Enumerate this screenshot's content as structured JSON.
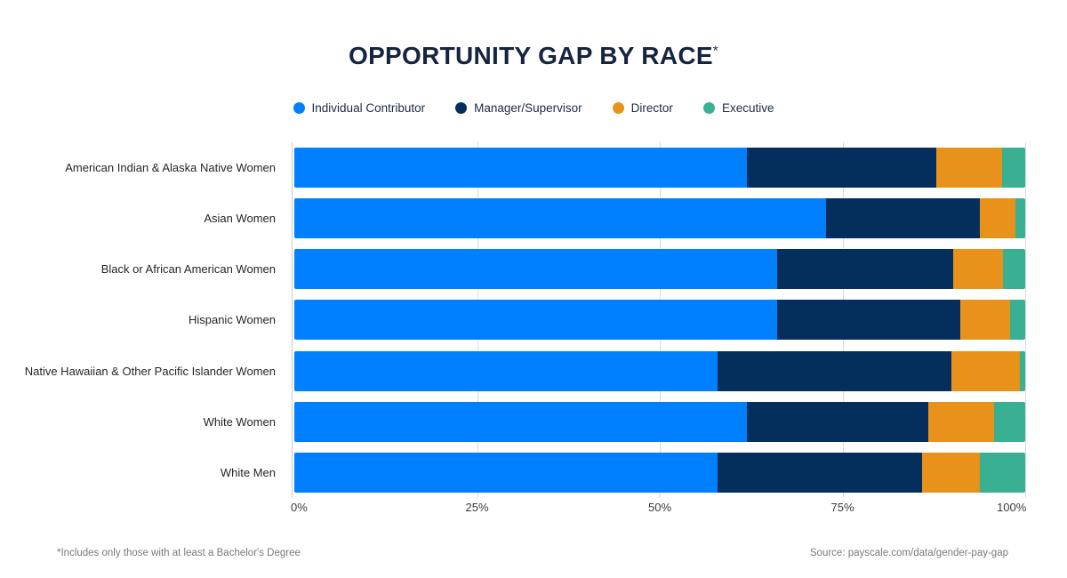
{
  "title": "OPPORTUNITY GAP BY RACE",
  "title_marker": "*",
  "footnote": "*Includes only those with at least a Bachelor's Degree",
  "source": "Source: payscale.com/data/gender-pay-gap",
  "colors": {
    "individual_contributor": "#0080FF",
    "manager_supervisor": "#042F5C",
    "director": "#E8921B",
    "executive": "#3AB093",
    "title": "#16243f",
    "grid": "#d8dade",
    "background": "#ffffff"
  },
  "legend": {
    "items": [
      {
        "label": "Individual Contributor",
        "color": "#0080FF",
        "icon": "circle-swatch-icon"
      },
      {
        "label": "Manager/Supervisor",
        "color": "#042F5C",
        "icon": "circle-swatch-icon"
      },
      {
        "label": "Director",
        "color": "#E8921B",
        "icon": "circle-swatch-icon"
      },
      {
        "label": "Executive",
        "color": "#3AB093",
        "icon": "circle-swatch-icon"
      }
    ]
  },
  "chart_data": {
    "type": "bar",
    "orientation": "horizontal",
    "stacked": true,
    "stack_mode": "percent",
    "title": "OPPORTUNITY GAP BY RACE*",
    "xlabel": "",
    "ylabel": "",
    "xlim": [
      0,
      100
    ],
    "xticks": [
      0,
      25,
      50,
      75,
      100
    ],
    "xtick_labels": [
      "0%",
      "25%",
      "50%",
      "75%",
      "100%"
    ],
    "grid": true,
    "legend_position": "top-center",
    "categories": [
      "American Indian & Alaska Native Women",
      "Asian Women",
      "Black or African American Women",
      "Hispanic Women",
      "Native Hawaiian & Other Pacific Islander Women",
      "White Women",
      "White Men"
    ],
    "series": [
      {
        "name": "Individual Contributor",
        "color": "#0080FF",
        "values": [
          61.9,
          72.8,
          66.0,
          66.0,
          57.9,
          61.9,
          57.9
        ]
      },
      {
        "name": "Manager/Supervisor",
        "color": "#042F5C",
        "values": [
          25.9,
          21.0,
          24.1,
          25.1,
          32.0,
          24.9,
          28.0
        ]
      },
      {
        "name": "Director",
        "color": "#E8921B",
        "values": [
          9.0,
          4.9,
          6.8,
          6.8,
          9.4,
          9.0,
          7.9
        ]
      },
      {
        "name": "Executive",
        "color": "#3AB093",
        "values": [
          3.2,
          1.3,
          3.1,
          2.1,
          0.7,
          4.2,
          6.2
        ]
      }
    ]
  }
}
